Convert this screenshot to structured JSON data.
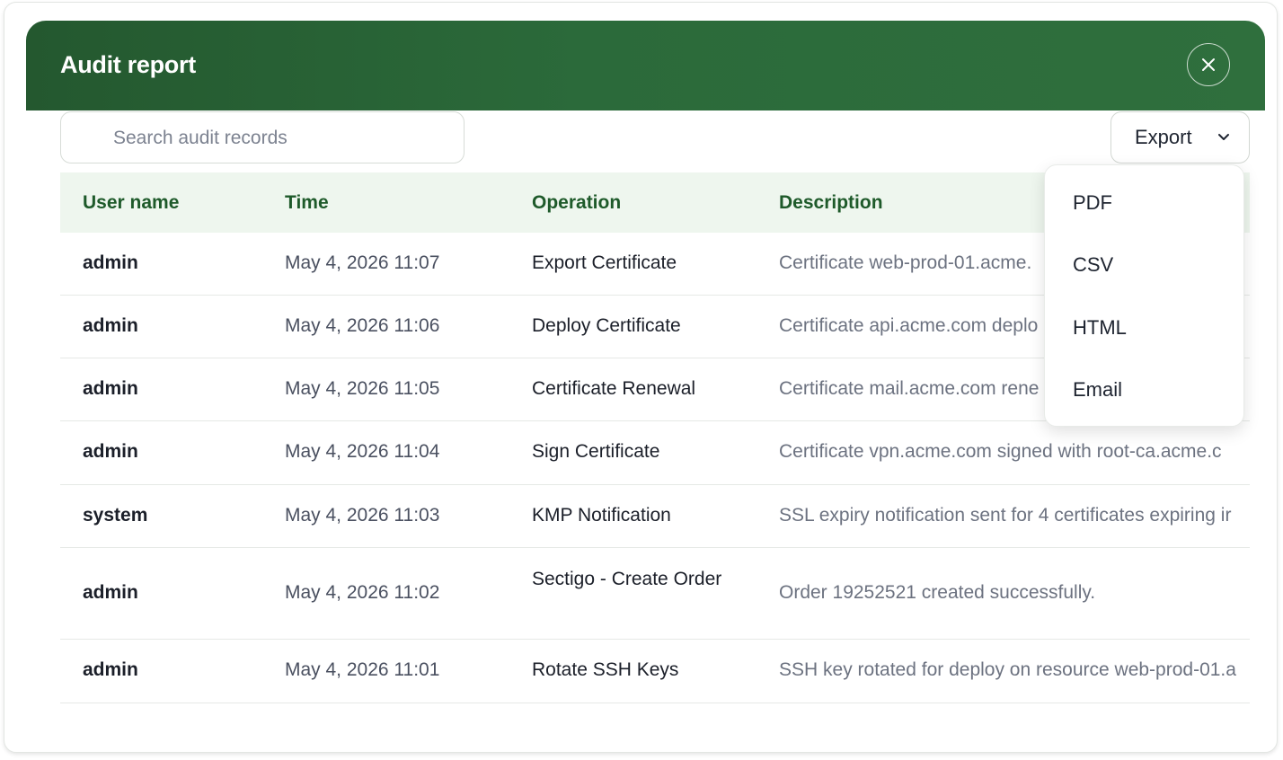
{
  "header": {
    "title": "Audit report"
  },
  "search": {
    "placeholder": "Search audit records",
    "value": ""
  },
  "export": {
    "label": "Export",
    "options": [
      "PDF",
      "CSV",
      "HTML",
      "Email"
    ]
  },
  "table": {
    "columns": [
      "User name",
      "Time",
      "Operation",
      "Description"
    ],
    "rows": [
      {
        "user": "admin",
        "time": "May 4, 2026 11:07",
        "operation": "Export Certificate",
        "description": "Certificate web-prod-01.acme."
      },
      {
        "user": "admin",
        "time": "May 4, 2026 11:06",
        "operation": "Deploy Certificate",
        "description": "Certificate api.acme.com deplo"
      },
      {
        "user": "admin",
        "time": "May 4, 2026 11:05",
        "operation": "Certificate Renewal",
        "description": "Certificate mail.acme.com rene"
      },
      {
        "user": "admin",
        "time": "May 4, 2026 11:04",
        "operation": "Sign Certificate",
        "description": "Certificate vpn.acme.com signed with root-ca.acme.c"
      },
      {
        "user": "system",
        "time": "May 4, 2026 11:03",
        "operation": "KMP Notification",
        "description": "SSL expiry notification sent for 4 certificates expiring ir"
      },
      {
        "user": "admin",
        "time": "May 4, 2026 11:02",
        "operation": "Sectigo - Create Order",
        "description": "Order 19252521 created successfully."
      },
      {
        "user": "admin",
        "time": "May 4, 2026 11:01",
        "operation": "Rotate SSH Keys",
        "description": "SSH key rotated for deploy on resource web-prod-01.a"
      }
    ]
  },
  "colors": {
    "header_green": "#2b6a3a",
    "column_header_bg": "#eef6ee",
    "column_header_text": "#1e5a2a"
  },
  "icons": {
    "close": "close-icon",
    "dropdown": "chevron-down-icon"
  }
}
